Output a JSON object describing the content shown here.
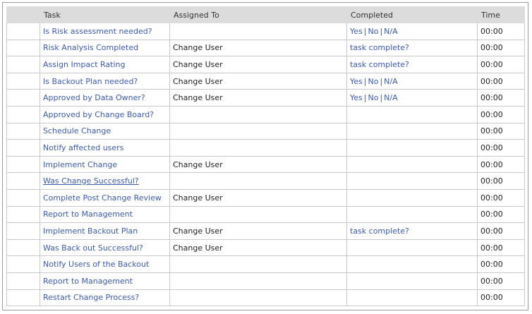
{
  "columns": [
    "",
    "Task",
    "Assigned To",
    "Completed",
    "Time"
  ],
  "rows": [
    {
      "task": "Is Risk assessment needed?",
      "assigned": "",
      "completed": {
        "kind": "yesno",
        "options": [
          "Yes",
          "No",
          "N/A"
        ]
      },
      "time": "00:00"
    },
    {
      "task": "Risk Analysis Completed",
      "assigned": "Change User",
      "completed": {
        "kind": "link",
        "text": "task complete?"
      },
      "time": "00:00"
    },
    {
      "task": "Assign Impact Rating",
      "assigned": "Change User",
      "completed": {
        "kind": "link",
        "text": "task complete?"
      },
      "time": "00:00"
    },
    {
      "task": "Is Backout Plan needed?",
      "assigned": "Change User",
      "completed": {
        "kind": "yesno",
        "options": [
          "Yes",
          "No",
          "N/A"
        ]
      },
      "time": "00:00"
    },
    {
      "task": "Approved by Data Owner?",
      "assigned": "Change User",
      "completed": {
        "kind": "yesno",
        "options": [
          "Yes",
          "No",
          "N/A"
        ]
      },
      "time": "00:00"
    },
    {
      "task": "Approved by Change Board?",
      "assigned": "",
      "completed": {
        "kind": "none"
      },
      "time": "00:00"
    },
    {
      "task": "Schedule Change",
      "assigned": "",
      "completed": {
        "kind": "none"
      },
      "time": "00:00"
    },
    {
      "task": "Notify affected users",
      "assigned": "",
      "completed": {
        "kind": "none"
      },
      "time": "00:00"
    },
    {
      "task": "Implement Change",
      "assigned": "Change User",
      "completed": {
        "kind": "none"
      },
      "time": "00:00"
    },
    {
      "task": "Was Change Successful?",
      "underline": true,
      "assigned": "",
      "completed": {
        "kind": "none"
      },
      "time": "00:00"
    },
    {
      "task": "Complete Post Change Review",
      "assigned": "Change User",
      "completed": {
        "kind": "none"
      },
      "time": "00:00"
    },
    {
      "task": "Report to Management",
      "assigned": "",
      "completed": {
        "kind": "none"
      },
      "time": "00:00"
    },
    {
      "task": "Implement Backout Plan",
      "assigned": "Change User",
      "completed": {
        "kind": "link",
        "text": "task complete?"
      },
      "time": "00:00"
    },
    {
      "task": "Was Back out Successful?",
      "assigned": "Change User",
      "completed": {
        "kind": "none"
      },
      "time": "00:00"
    },
    {
      "task": "Notify Users of the Backout",
      "assigned": "",
      "completed": {
        "kind": "none"
      },
      "time": "00:00"
    },
    {
      "task": "Report to Management",
      "assigned": "",
      "completed": {
        "kind": "none"
      },
      "time": "00:00"
    },
    {
      "task": "Restart Change Process?",
      "assigned": "",
      "completed": {
        "kind": "none"
      },
      "time": "00:00"
    }
  ],
  "separator": "|",
  "colors": {
    "link": "#3b5bb0",
    "header_bg": "#dcdcdc",
    "grid": "#c8c8c8"
  }
}
